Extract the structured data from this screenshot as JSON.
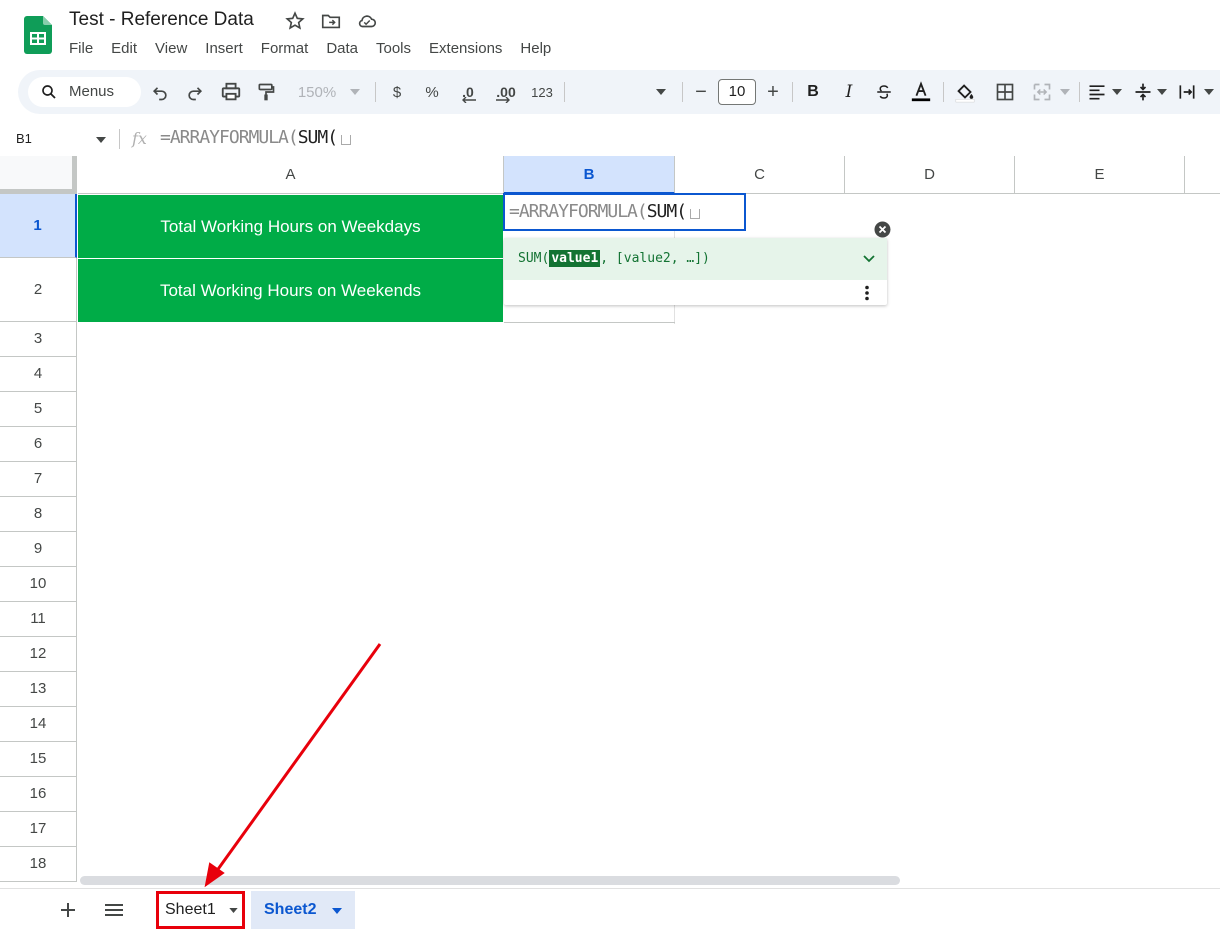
{
  "app": {
    "title": "Test - Reference Data",
    "menu": [
      "File",
      "Edit",
      "View",
      "Insert",
      "Format",
      "Data",
      "Tools",
      "Extensions",
      "Help"
    ]
  },
  "toolbar": {
    "search_label": "Menus",
    "zoom": "150%",
    "currency": "$",
    "percent": "%",
    "decimal_decrease": ".0",
    "decimal_increase": ".00",
    "number_format": "123",
    "font_size": "10",
    "minus": "−",
    "plus": "+",
    "bold": "B",
    "italic": "I"
  },
  "formula_bar": {
    "cell_ref": "B1",
    "fx": "fx",
    "formula_gray": "=ARRAYFORMULA(",
    "formula_dark": "SUM("
  },
  "grid": {
    "columns": [
      "A",
      "B",
      "C",
      "D",
      "E"
    ],
    "rows": [
      "1",
      "2",
      "3",
      "4",
      "5",
      "6",
      "7",
      "8",
      "9",
      "10",
      "11",
      "12",
      "13",
      "14",
      "15",
      "16",
      "17",
      "18"
    ],
    "cells": {
      "A1": "Total Working Hours on Weekdays",
      "A2": "Total Working Hours on Weekends"
    },
    "selected_column": "B",
    "selected_row": "1"
  },
  "editor": {
    "text_gray": "=ARRAYFORMULA(",
    "text_dark": "SUM("
  },
  "hint": {
    "fn_open": "SUM(",
    "param": "value1",
    "rest": ", [value2, …])"
  },
  "sheets": {
    "tabs": [
      "Sheet1",
      "Sheet2"
    ],
    "active": "Sheet2"
  },
  "colors": {
    "green_fill": "#00ac47",
    "accent_blue": "#0b57d0",
    "annotation_red": "#e8000b"
  }
}
